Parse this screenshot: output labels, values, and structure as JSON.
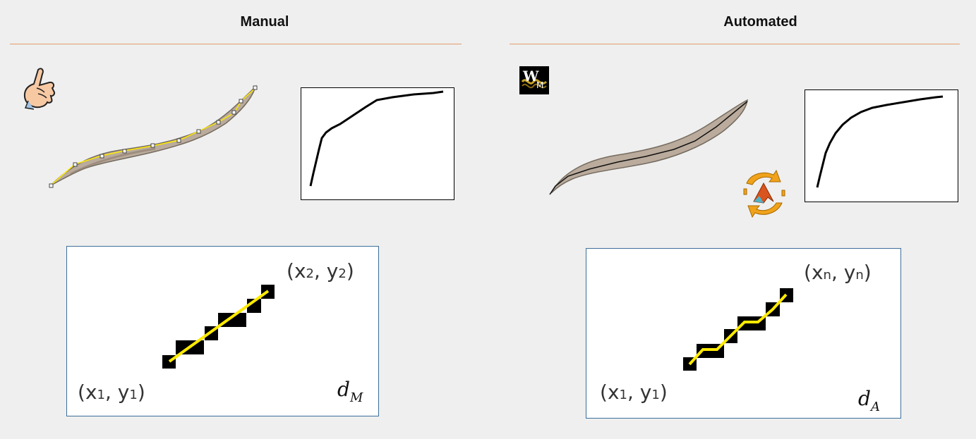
{
  "manual": {
    "title": "Manual",
    "start_point": {
      "x": "x",
      "sub_x": "1",
      "y": "y",
      "sub_y": "1"
    },
    "end_point": {
      "x": "x",
      "sub_x": "2",
      "y": "y",
      "sub_y": "2"
    },
    "distance_label": {
      "d": "d",
      "sub": "M"
    }
  },
  "automated": {
    "title": "Automated",
    "start_point": {
      "x": "x",
      "sub_x": "1",
      "y": "y",
      "sub_y": "1"
    },
    "end_point": {
      "x": "x",
      "sub_x": "n",
      "y": "y",
      "sub_y": "n"
    },
    "distance_label": {
      "d": "d",
      "sub": "A"
    },
    "logo_letters": {
      "main": "W",
      "sub": "M"
    }
  },
  "colors": {
    "rule": "#e59b6b",
    "trace_line": "#ffea00",
    "worm_body": "#b8a898",
    "box_border": "#3c6e9a"
  },
  "icons": [
    "pointing-hand-icon",
    "wormmeasure-logo-icon",
    "matlab-cycle-icon"
  ]
}
